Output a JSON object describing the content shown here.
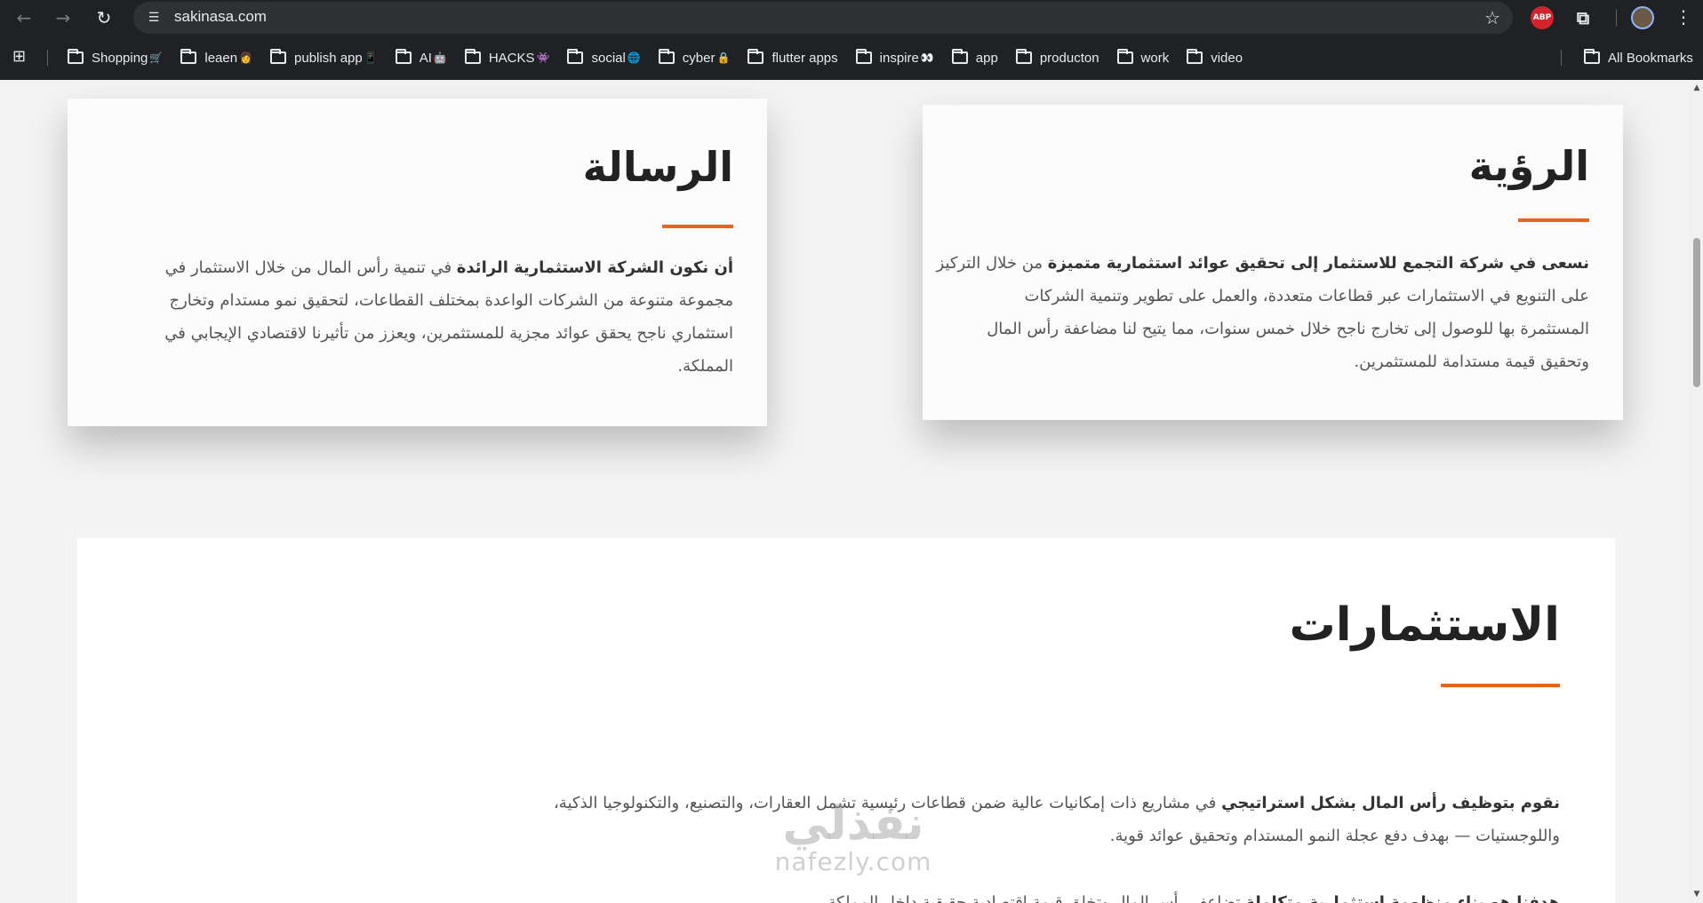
{
  "browser": {
    "url": "sakinasa.com",
    "extensions": {
      "abp_label": "ABP"
    },
    "bookmarks": [
      {
        "label": "Shopping",
        "emoji": "🛒"
      },
      {
        "label": "leaen",
        "emoji": "👩"
      },
      {
        "label": "publish app",
        "emoji": "📱"
      },
      {
        "label": "AI",
        "emoji": "🤖"
      },
      {
        "label": "HACKS",
        "emoji": "👾"
      },
      {
        "label": "social",
        "emoji": "🌐"
      },
      {
        "label": "cyber",
        "emoji": "🔒"
      },
      {
        "label": "flutter apps",
        "emoji": ""
      },
      {
        "label": "inspire",
        "emoji": "👀"
      },
      {
        "label": "app",
        "emoji": ""
      },
      {
        "label": "producton",
        "emoji": ""
      },
      {
        "label": "work",
        "emoji": ""
      },
      {
        "label": "video",
        "emoji": ""
      }
    ],
    "all_bookmarks_label": "All Bookmarks"
  },
  "vision": {
    "title": "الرؤية",
    "lead": "نسعى في شركة التجمع للاستثمار إلى تحقيق عوائد استثمارية متميزة",
    "lines": [
      " من خلال التركيز",
      "على التنويع في الاستثمارات عبر قطاعات متعددة، والعمل على تطوير وتنمية الشركات",
      "المستثمرة بها للوصول إلى تخارج ناجح خلال خمس سنوات، مما يتيح لنا مضاعفة رأس المال",
      "وتحقيق قيمة مستدامة للمستثمرين."
    ]
  },
  "mission": {
    "title": "الرسالة",
    "lead": "أن نكون الشركة الاستثمارية الرائدة",
    "lines": [
      " في تنمية رأس المال من خلال الاستثمار في",
      "مجموعة متنوعة من الشركات الواعدة بمختلف القطاعات، لتحقيق نمو مستدام وتخارج",
      "استثماري ناجح يحقق عوائد مجزية للمستثمرين، ويعزز من تأثيرنا لاقتصادي الإيجابي في",
      "المملكة."
    ]
  },
  "investments": {
    "title": "الاستثمارات",
    "p1_lead": "نقوم بتوظيف رأس المال بشكل استراتيجي",
    "p1_rest": " في مشاريع ذات إمكانيات عالية ضمن قطاعات رئيسية تشمل العقارات، والتصنيع، والتكنولوجيا الذكية،",
    "p1_line2": "واللوجستيات — بهدف دفع عجلة النمو المستدام وتحقيق عوائد قوية.",
    "p2_lead": "هدفنا هو بناء منظومة استثمارية متكاملة",
    "p2_rest": " تضاعف رأس المال وتخلق قيمة اقتصادية حقيقية داخل المملكة"
  },
  "watermark": {
    "arabic": "نفذلي",
    "latin": "nafezly.com"
  },
  "colors": {
    "accent": "#e8651e",
    "chrome_bg": "#202124",
    "omnibox_bg": "#303134"
  }
}
